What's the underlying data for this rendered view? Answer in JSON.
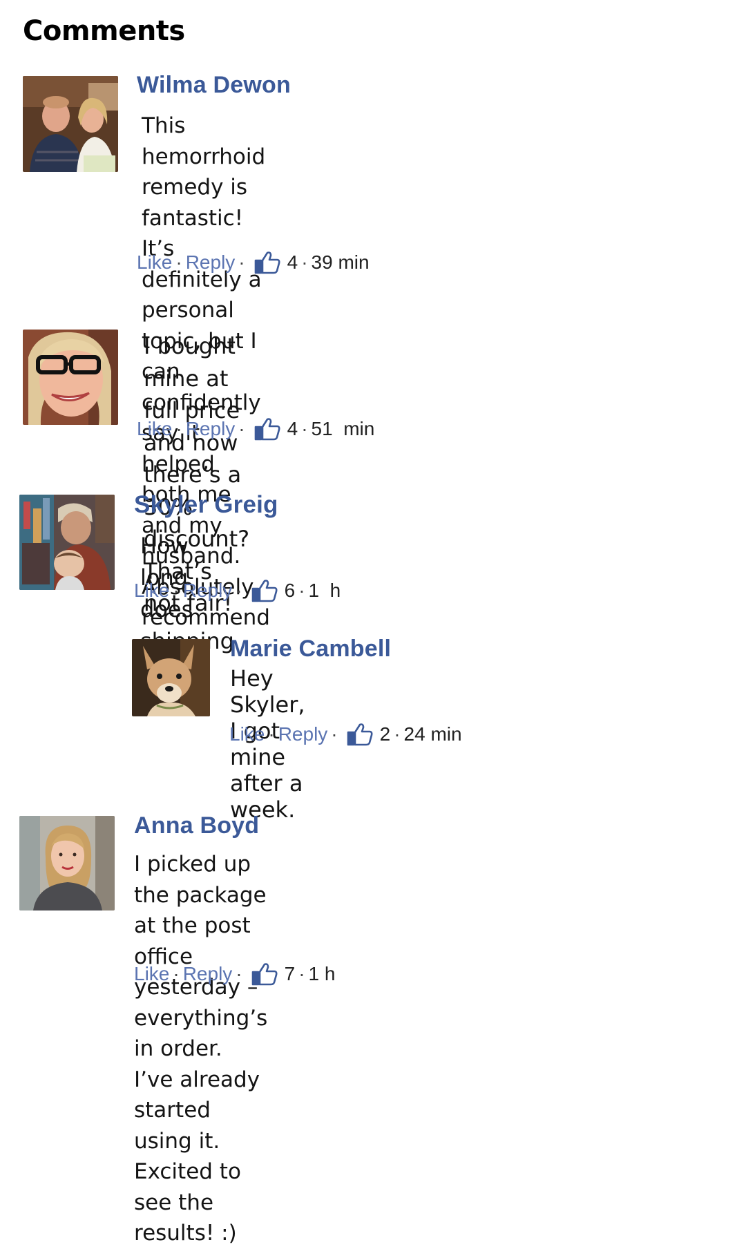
{
  "heading": "Comments",
  "accent_color": "#3b5998",
  "like_icon": "thumbs-up-icon",
  "comments": [
    {
      "name": "Wilma Dewon",
      "avatar": "couple-photo",
      "lines": [
        "This hemorrhoid remedy is fantastic! It’s",
        "definitely a personal topic, but I can confidently",
        "say it helped both me and my husband.",
        "Absolutely recommend it!"
      ],
      "like_label": "Like",
      "reply_label": "Reply",
      "likes": "4",
      "time": "39 min"
    },
    {
      "name": "",
      "avatar": "woman-glasses-photo",
      "lines": [
        "I bought mine at full price and now there’s a 30%",
        "discount? That’s not fair!"
      ],
      "like_label": "Like",
      "reply_label": "Reply",
      "likes": "4",
      "time": "51  min"
    },
    {
      "name": "Skyler Greig",
      "avatar": "woman-child-photo",
      "lines": [
        "How long does shipping take?"
      ],
      "like_label": "Like",
      "reply_label": "Reply",
      "likes": "6",
      "time": "1  h"
    },
    {
      "name": "Marie Cambell",
      "avatar": "dog-photo",
      "lines": [
        "Hey Skyler, I got mine after a",
        "week."
      ],
      "like_label": "Like",
      "reply_label": "Reply",
      "likes": "2",
      "time": "24 min"
    },
    {
      "name": "Anna Boyd",
      "avatar": "woman-portrait-photo",
      "lines": [
        "I picked up the package at the post office yesterday –",
        "everything’s in order. I’ve already started using it.",
        "Excited to see the results! :)"
      ],
      "like_label": "Like",
      "reply_label": "Reply",
      "likes": "7",
      "time": "1 h"
    }
  ]
}
